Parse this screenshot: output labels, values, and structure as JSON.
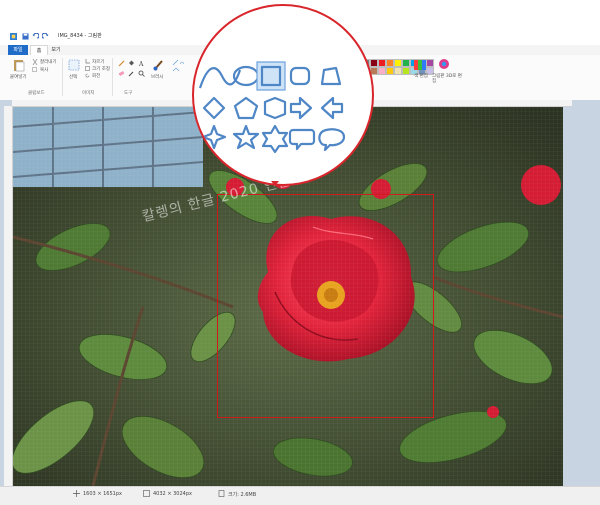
{
  "window": {
    "title": "IMG_8434 - 그림판"
  },
  "tabs": {
    "file": "파일",
    "home": "홈",
    "view": "보기"
  },
  "clipboard": {
    "paste": "붙여넣기",
    "cut": "잘라내기",
    "copy": "복사",
    "group": "클립보드"
  },
  "image": {
    "select": "선택",
    "crop": "자르기",
    "resize": "크기 조정",
    "rotate": "회전",
    "group": "이미지"
  },
  "tools": {
    "group": "도구"
  },
  "brushes": {
    "label": "브러시"
  },
  "colors": {
    "edit_colors": "색 편집",
    "paint3d": "그림판 3D로 편집",
    "palette": [
      "#000000",
      "#7f7f7f",
      "#880015",
      "#ed1c24",
      "#ff7f27",
      "#fff200",
      "#22b14c",
      "#00a2e8",
      "#3f48cc",
      "#a349a4",
      "#ffffff",
      "#c3c3c3",
      "#b97a57",
      "#ffaec9",
      "#ffc90e",
      "#efe4b0",
      "#b5e61d",
      "#99d9ea",
      "#7092be",
      "#c8bfe7"
    ]
  },
  "magnifier": {
    "content": "shapes gallery",
    "highlight": "#d8262c",
    "selected_shape": "rectangle"
  },
  "shapes": [
    "curve",
    "oval",
    "rectangle",
    "rounded-rectangle",
    "polygon",
    "diamond",
    "pentagon",
    "hexagon",
    "right-arrow",
    "left-arrow",
    "four-point-star",
    "five-point-star",
    "six-point-star",
    "rounded-callout",
    "oval-callout"
  ],
  "canvas": {
    "watermark": "칼렝의 한글 2020 연습",
    "selection_color": "#d11a1a"
  },
  "status": {
    "cursor": "1603 × 1651px",
    "dimensions": "4032 × 3024px",
    "filesize": "크기: 2.6MB"
  }
}
